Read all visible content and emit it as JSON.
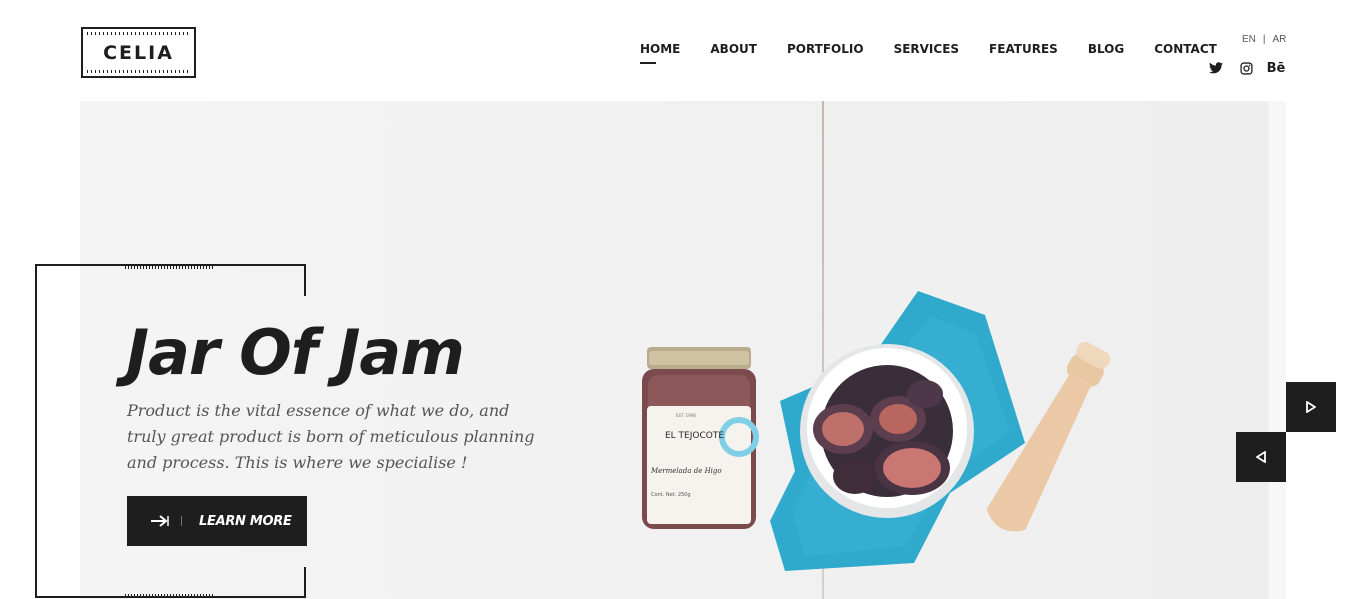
{
  "brand": {
    "logo_text": "CELIA"
  },
  "nav": {
    "items": [
      {
        "label": "HOME",
        "active": true
      },
      {
        "label": "ABOUT"
      },
      {
        "label": "PORTFOLIO"
      },
      {
        "label": "SERVICES"
      },
      {
        "label": "FEATURES"
      },
      {
        "label": "BLOG"
      },
      {
        "label": "CONTACT"
      }
    ]
  },
  "lang": {
    "en": "EN",
    "separator": "|",
    "ar": "AR"
  },
  "social": {
    "icons": [
      "twitter-icon",
      "instagram-icon",
      "behance-icon"
    ],
    "behance_label": "Bē"
  },
  "hero": {
    "title": "Jar Of Jam",
    "description": "Product is the vital essence of what we do, and truly great product is born of meticulous planning and process. This is where we specialise !",
    "button_label": "LEARN MORE",
    "jar_label": "EL TEJOCOTE",
    "jar_small": "EST. 1998",
    "jar_script": "Mermelada de Higo",
    "jar_weight": "Cont. Net. 250g"
  },
  "colors": {
    "dark": "#1e1e1e",
    "accent_blue": "#2fa9cc",
    "background": "#f2f2f2"
  }
}
